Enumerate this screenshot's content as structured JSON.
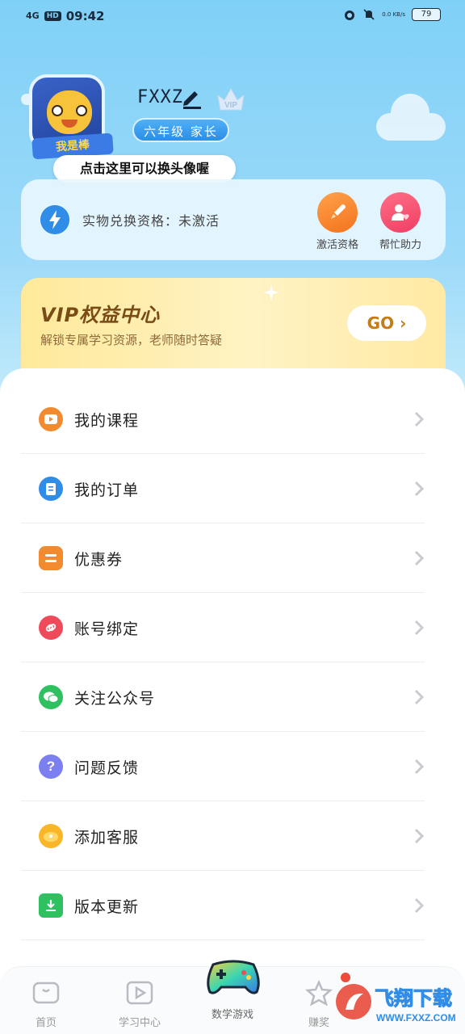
{
  "status_bar": {
    "network": "4G",
    "hd": "HD",
    "time": "09:42",
    "net_speed": "0.0 KB/s",
    "battery": "79"
  },
  "profile": {
    "avatar_text": "我是棒",
    "username": "FXXZ",
    "vip_tag": "VIP",
    "grade": "六年级 家长",
    "tip": "点击这里可以换头像喔"
  },
  "exchange": {
    "label": "实物兑换资格：未激活",
    "actions": [
      {
        "label": "激活资格",
        "icon": "rocket-icon"
      },
      {
        "label": "帮忙助力",
        "icon": "user-heart-icon"
      }
    ]
  },
  "vip_banner": {
    "title": "VIP权益中心",
    "subtitle": "解锁专属学习资源，老师随时答疑",
    "button": "GO"
  },
  "menu": [
    {
      "label": "我的课程",
      "icon": "video-icon",
      "color": "#f28b30"
    },
    {
      "label": "我的订单",
      "icon": "clipboard-icon",
      "color": "#2f8de8"
    },
    {
      "label": "优惠券",
      "icon": "coupon-icon",
      "color": "#f28b30"
    },
    {
      "label": "账号绑定",
      "icon": "link-icon",
      "color": "#ef4a5a"
    },
    {
      "label": "关注公众号",
      "icon": "wechat-icon",
      "color": "#2fc060"
    },
    {
      "label": "问题反馈",
      "icon": "question-icon",
      "color": "#7b7ff0"
    },
    {
      "label": "添加客服",
      "icon": "customer-service-icon",
      "color": "#f8b628"
    },
    {
      "label": "版本更新",
      "icon": "download-icon",
      "color": "#2fc060"
    }
  ],
  "bottom_nav": [
    {
      "label": "首页",
      "icon": "home-icon"
    },
    {
      "label": "学习中心",
      "icon": "play-icon"
    },
    {
      "label": "数学游戏",
      "icon": "gamepad-icon"
    },
    {
      "label": "赚奖",
      "icon": "star-icon"
    }
  ],
  "watermark": {
    "text": "飞翔下载",
    "url_text": "WWW.FXXZ.COM"
  }
}
